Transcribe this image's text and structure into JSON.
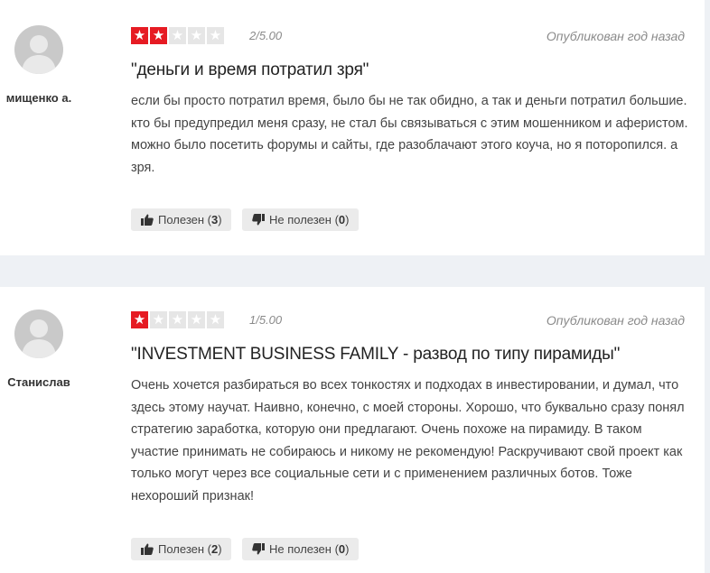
{
  "reviews": [
    {
      "author": "мищенко а.",
      "rating": 2,
      "rating_max": 5,
      "score_text": "2/5.00",
      "published": "Опубликован год назад",
      "title": "\"деньги и время потратил зря\"",
      "body": "если бы просто потратил время, было бы не так обидно, а так и деньги потратил большие. кто бы предупредил меня сразу, не стал бы связываться с этим мошенником и аферистом. можно было посетить форумы и сайты, где разоблачают этого коуча, но я поторопился. а зря.",
      "helpful_label": "Полезен",
      "helpful_count": "3",
      "unhelpful_label": "Не полезен",
      "unhelpful_count": "0"
    },
    {
      "author": "Станислав",
      "rating": 1,
      "rating_max": 5,
      "score_text": "1/5.00",
      "published": "Опубликован год назад",
      "title": "\"INVESTMENT BUSINESS FAMILY - развод по типу пирамиды\"",
      "body": "Очень хочется разбираться во всех тонкостях и подходах в инвестировании, и думал, что здесь этому научат. Наивно, конечно, с моей стороны. Хорошо, что буквально сразу понял стратегию заработка, которую они предлагают. Очень похоже на пирамиду. В таком участие принимать не собираюсь и никому не рекомендую! Раскручивают свой проект как только могут через все социальные сети и с применением различных ботов. Тоже нехороший признак!",
      "helpful_label": "Полезен",
      "helpful_count": "2",
      "unhelpful_label": "Не полезен",
      "unhelpful_count": "0"
    }
  ],
  "icons": {
    "avatar": "user-silhouette-icon",
    "star": "star-icon",
    "thumbs_up": "thumbs-up-icon",
    "thumbs_down": "thumbs-down-icon"
  },
  "colors": {
    "star_on": "#e61b23",
    "star_off": "#e6e6e6",
    "button_bg": "#ebebeb",
    "page_bg": "#eef1f5"
  }
}
